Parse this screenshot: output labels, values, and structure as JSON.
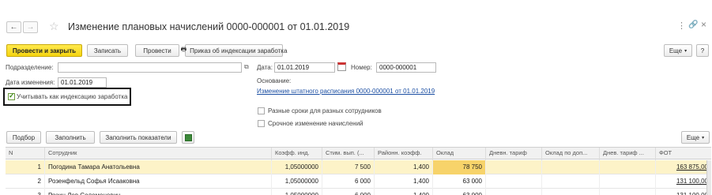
{
  "header": {
    "title": "Изменение плановых начислений 0000-000001 от 01.01.2019"
  },
  "toolbar": {
    "post_close": "Провести и закрыть",
    "save": "Записать",
    "post": "Провести",
    "order": "Приказ об индексации заработка",
    "more": "Еще",
    "help": "?"
  },
  "form": {
    "department_label": "Подразделение:",
    "department_value": "",
    "date_label": "Дата:",
    "date_value": "01.01.2019",
    "number_label": "Номер:",
    "number_value": "0000-000001",
    "change_date_label": "Дата изменения:",
    "change_date_value": "01.01.2019",
    "indexation_label": "Учитывать как индексацию заработка",
    "basis_label": "Основание:",
    "basis_link": "Изменение штатного расписания 0000-000001 от 01.01.2019",
    "different_terms_label": "Разные сроки для разных сотрудников",
    "urgent_label": "Срочное изменение начислений"
  },
  "table_toolbar": {
    "pick": "Подбор",
    "fill": "Заполнить",
    "fill_indicators": "Заполнить показатели",
    "more": "Еще"
  },
  "table": {
    "columns": [
      "N",
      "Сотрудник",
      "Коэфф. инд.",
      "Стим. вып. (...",
      "Районн. коэфф.",
      "Оклад",
      "Дневн. тариф",
      "Оклад по доп...",
      "Днев. тариф ...",
      "ФОТ"
    ],
    "rows": [
      {
        "n": "1",
        "employee": "Погодина Тамара Анатольевна",
        "coef": "1,05000000",
        "stim": "7 500",
        "district": "1,400",
        "salary": "78 750",
        "daily": "",
        "salary_add": "",
        "daily_add": "",
        "fot": "163 875,00"
      },
      {
        "n": "2",
        "employee": "Розенфельд Софья Исааковна",
        "coef": "1,05000000",
        "stim": "6 000",
        "district": "1,400",
        "salary": "63 000",
        "daily": "",
        "salary_add": "",
        "daily_add": "",
        "fot": "131 100,00"
      },
      {
        "n": "3",
        "employee": "Розин Лев Соломонович",
        "coef": "1,05000000",
        "stim": "6 000",
        "district": "1,400",
        "salary": "63 000",
        "daily": "",
        "salary_add": "",
        "daily_add": "",
        "fot": "131 100,00"
      }
    ]
  },
  "colors": {
    "accent_yellow": "#f5d40f",
    "link_blue": "#1c4fa3",
    "selected_row": "#fdf3c8",
    "highlight_cell": "#f7d36a"
  }
}
